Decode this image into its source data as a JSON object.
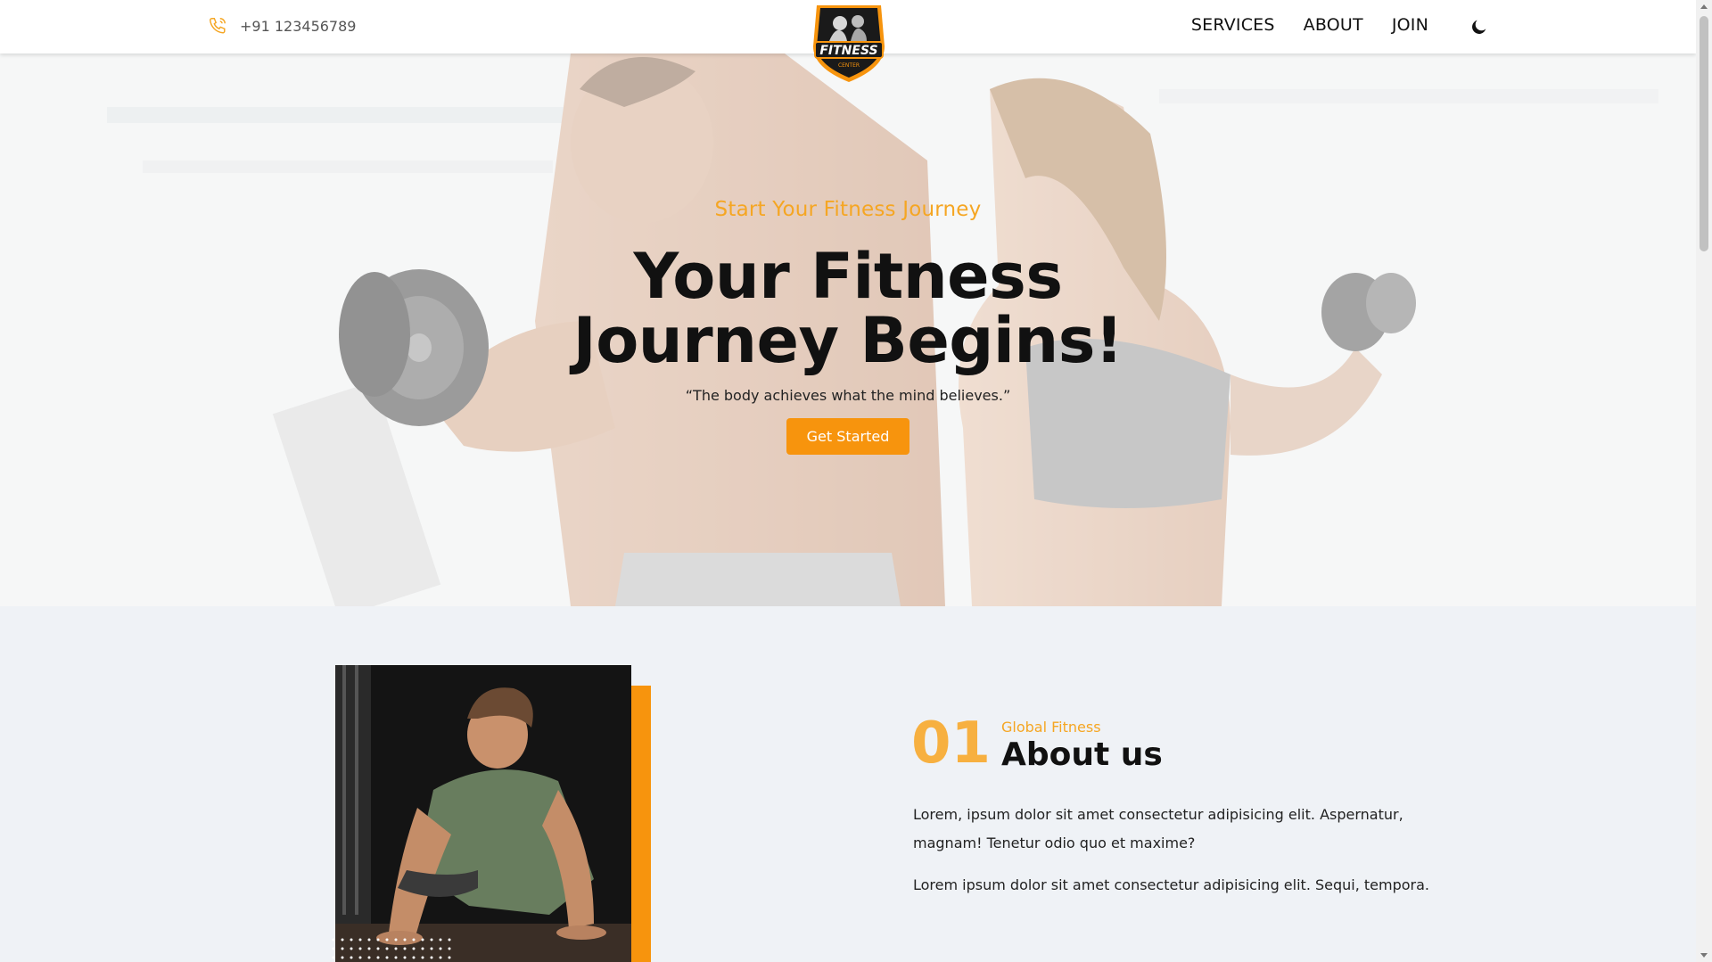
{
  "header": {
    "phone": "+91 123456789",
    "logo_text": "FITNESS",
    "logo_subtext": "CENTER",
    "nav": [
      "SERVICES",
      "ABOUT",
      "JOIN"
    ]
  },
  "hero": {
    "subtitle": "Start Your Fitness Journey",
    "title_line1": "Your Fitness",
    "title_line2": "Journey Begins!",
    "quote": "“The body achieves what the mind believes.”",
    "cta": "Get Started"
  },
  "about": {
    "number": "01",
    "kicker": "Global Fitness",
    "title": "About us",
    "paragraph1": "Lorem, ipsum dolor sit amet consectetur adipisicing elit. Aspernatur, magnam! Tenetur odio quo et maxime?",
    "paragraph2": "Lorem ipsum dolor sit amet consectetur adipisicing elit. Sequi, tempora."
  },
  "colors": {
    "accent": "#f7940d",
    "accent_light": "#f5a623",
    "section_bg": "#eff2f6"
  }
}
